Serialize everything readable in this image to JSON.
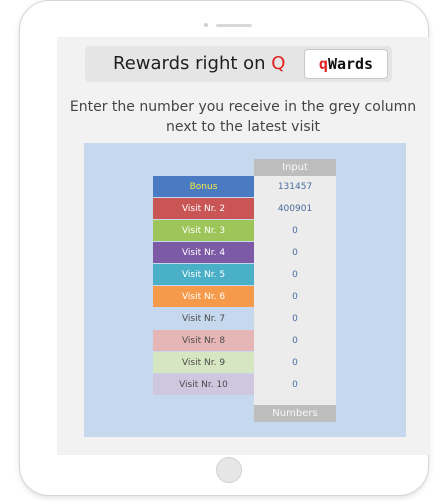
{
  "brand": {
    "prefix": "Rewards right on ",
    "highlight": "Q",
    "logo_q": "q",
    "logo_rest": "Wards"
  },
  "instruction": "Enter the number you receive in the grey column next to the latest visit",
  "table": {
    "input_header": "Input",
    "footer": "Numbers",
    "rows": [
      {
        "label": "Bonus",
        "value": "131457",
        "color": "#4a7ac2",
        "text_color": "#f4e842"
      },
      {
        "label": "Visit Nr. 2",
        "value": "400901",
        "color": "#c95555",
        "text_color": "#ffffff"
      },
      {
        "label": "Visit Nr. 3",
        "value": "0",
        "color": "#9dc55a",
        "text_color": "#ffffff"
      },
      {
        "label": "Visit Nr. 4",
        "value": "0",
        "color": "#7c5aa6",
        "text_color": "#ffffff"
      },
      {
        "label": "Visit Nr. 5",
        "value": "0",
        "color": "#4ab0c8",
        "text_color": "#ffffff"
      },
      {
        "label": "Visit Nr. 6",
        "value": "0",
        "color": "#f59a4a",
        "text_color": "#ffffff"
      },
      {
        "label": "Visit Nr. 7",
        "value": "0",
        "color": "#c6d8ee",
        "text_color": "#4a4a4a"
      },
      {
        "label": "Visit Nr. 8",
        "value": "0",
        "color": "#e6b6b6",
        "text_color": "#4a4a4a"
      },
      {
        "label": "Visit Nr. 9",
        "value": "0",
        "color": "#d7e6c2",
        "text_color": "#4a4a4a"
      },
      {
        "label": "Visit Nr. 10",
        "value": "0",
        "color": "#cfc6e0",
        "text_color": "#4a4a4a"
      }
    ]
  }
}
